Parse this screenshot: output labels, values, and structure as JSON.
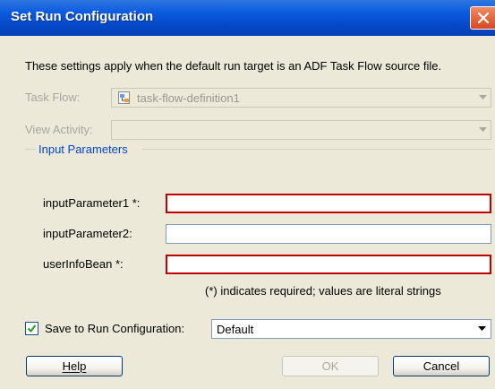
{
  "window": {
    "title": "Set Run Configuration"
  },
  "description": "These settings apply when the default run target is an ADF Task Flow source file.",
  "task_flow": {
    "label": "Task Flow:",
    "value": "task-flow-definition1"
  },
  "view_activity": {
    "label": "View Activity:",
    "value": ""
  },
  "input_parameters": {
    "group_label": "Input Parameters",
    "fields": [
      {
        "label": "inputParameter1 *:",
        "value": "",
        "required": true
      },
      {
        "label": "inputParameter2:",
        "value": "",
        "required": false
      },
      {
        "label": "userInfoBean *:",
        "value": "",
        "required": true
      }
    ],
    "note": "(*) indicates required; values are literal strings"
  },
  "save": {
    "label": "Save to Run Configuration:",
    "checked": true,
    "selected": "Default"
  },
  "buttons": {
    "help": "Help",
    "ok": "OK",
    "cancel": "Cancel"
  },
  "colors": {
    "title_bar": "#0a5be0",
    "dialog_bg": "#ece9d8",
    "required_border": "#c00000",
    "group_label": "#0046d5"
  }
}
